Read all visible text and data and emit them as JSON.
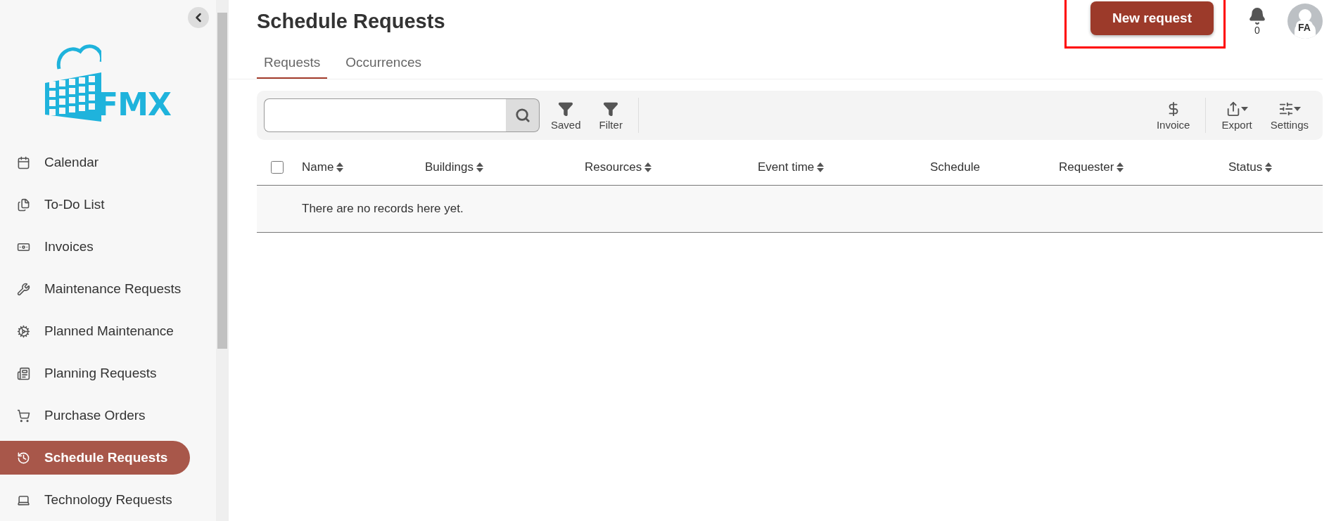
{
  "sidebar": {
    "logo": "FMX",
    "items": [
      {
        "label": "Calendar",
        "selected": false
      },
      {
        "label": "To-Do List",
        "selected": false
      },
      {
        "label": "Invoices",
        "selected": false
      },
      {
        "label": "Maintenance Requests",
        "selected": false
      },
      {
        "label": "Planned Maintenance",
        "selected": false
      },
      {
        "label": "Planning Requests",
        "selected": false
      },
      {
        "label": "Purchase Orders",
        "selected": false
      },
      {
        "label": "Schedule Requests",
        "selected": true
      },
      {
        "label": "Technology Requests",
        "selected": false
      }
    ]
  },
  "header": {
    "title": "Schedule Requests",
    "new_button": "New request",
    "notifications": "0",
    "avatar": "FA"
  },
  "tabs": [
    {
      "label": "Requests",
      "selected": true
    },
    {
      "label": "Occurrences",
      "selected": false
    }
  ],
  "toolbar": {
    "left": [
      {
        "label": "Saved",
        "menu": false
      },
      {
        "label": "Filter",
        "menu": false
      }
    ],
    "right": [
      {
        "label": "Invoice",
        "menu": false
      },
      {
        "label": "Export",
        "menu": true
      },
      {
        "label": "Settings",
        "menu": true
      }
    ]
  },
  "table": {
    "select_all": {
      "checked": false
    },
    "columns": [
      {
        "label": "Name",
        "sortable": true
      },
      {
        "label": "Buildings",
        "sortable": true
      },
      {
        "label": "Resources",
        "sortable": true
      },
      {
        "label": "Event time",
        "sortable": true
      },
      {
        "label": "Schedule",
        "sortable": false
      },
      {
        "label": "Requester",
        "sortable": true
      },
      {
        "label": "Status",
        "sortable": true
      }
    ],
    "empty_message": "There are no records here yet."
  }
}
